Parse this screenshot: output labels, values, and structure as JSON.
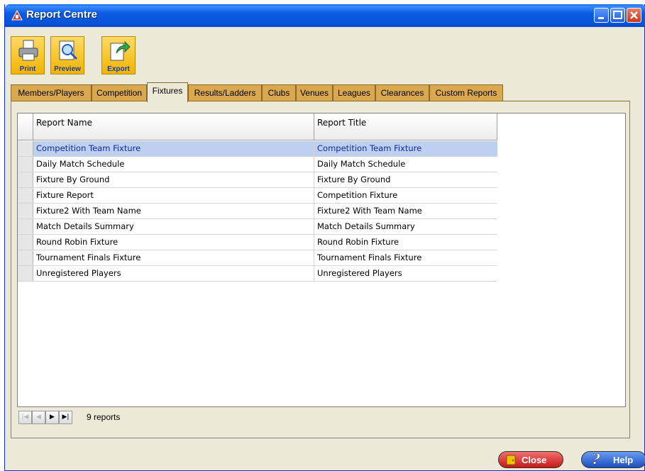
{
  "window": {
    "title": "Report Centre"
  },
  "toolbar": {
    "print_label": "Print",
    "preview_label": "Preview",
    "export_label": "Export"
  },
  "tabs": [
    {
      "label": "Members/Players",
      "active": false
    },
    {
      "label": "Competition",
      "active": false
    },
    {
      "label": "Fixtures",
      "active": true
    },
    {
      "label": "Results/Ladders",
      "active": false
    },
    {
      "label": "Clubs",
      "active": false
    },
    {
      "label": "Venues",
      "active": false
    },
    {
      "label": "Leagues",
      "active": false
    },
    {
      "label": "Clearances",
      "active": false
    },
    {
      "label": "Custom Reports",
      "active": false
    }
  ],
  "grid": {
    "columns": [
      "Report Name",
      "Report Title"
    ],
    "rows": [
      {
        "name": "Competition Team Fixture",
        "title": "Competition Team Fixture",
        "selected": true
      },
      {
        "name": "Daily Match Schedule",
        "title": "Daily Match Schedule",
        "selected": false
      },
      {
        "name": "Fixture By Ground",
        "title": "Fixture By Ground",
        "selected": false
      },
      {
        "name": "Fixture Report",
        "title": "Competition Fixture",
        "selected": false
      },
      {
        "name": "Fixture2 With Team Name",
        "title": "Fixture2 With Team Name",
        "selected": false
      },
      {
        "name": "Match Details Summary",
        "title": "Match Details Summary",
        "selected": false
      },
      {
        "name": "Round Robin Fixture",
        "title": "Round Robin Fixture",
        "selected": false
      },
      {
        "name": "Tournament Finals Fixture",
        "title": "Tournament Finals Fixture",
        "selected": false
      },
      {
        "name": "Unregistered Players",
        "title": "Unregistered Players",
        "selected": false
      }
    ]
  },
  "navigator": {
    "count_text": "9 reports"
  },
  "footer": {
    "close_label": "Close",
    "help_label": "Help"
  },
  "colors": {
    "titlebar": "#0a5ce0",
    "tab": "#d9a84f",
    "selection": "#bed0f0",
    "close": "#c81818",
    "help": "#1c4fbf"
  }
}
